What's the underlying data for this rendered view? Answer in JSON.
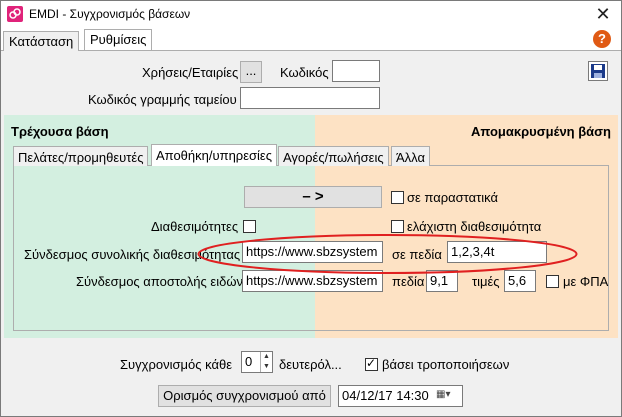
{
  "window": {
    "title": "EMDI - Συγχρονισμός βάσεων",
    "close_glyph": "✕"
  },
  "tabs": [
    {
      "label": "Κατάσταση"
    },
    {
      "label": "Ρυθμίσεις"
    }
  ],
  "help_glyph": "?",
  "settings": {
    "fiscal_years_label": "Χρήσεις/Εταιρίες",
    "browse_button": "...",
    "code_label": "Κωδικός",
    "code_value": "",
    "cashline_label": "Κωδικός γραμμής ταμείου",
    "cashline_value": ""
  },
  "current_db": {
    "title": "Τρέχουσα βάση"
  },
  "remote_db": {
    "title": "Απομακρυσμένη βάση"
  },
  "subtabs": [
    {
      "label": "Πελάτες/προμηθευτές"
    },
    {
      "label": "Αποθήκη/υπηρεσίες"
    },
    {
      "label": "Αγορές/πωλήσεις"
    },
    {
      "label": "Άλλα"
    }
  ],
  "warehouse": {
    "direction_button": "–   >",
    "in_documents_label": "σε παραστατικά",
    "availability_label": "Διαθεσιμότητες",
    "min_availability_label": "ελάχιστη διαθεσιμότητα",
    "total_availability_link_label": "Σύνδεσμος συνολικής διαθεσιμότητας",
    "total_availability_link_value": "https://www.sbzsystem",
    "fields_label": "σε πεδία",
    "fields_value": "1,2,3,4t",
    "shipping_link_label": "Σύνδεσμος αποστολής ειδών",
    "shipping_link_value": "https://www.sbzsystem",
    "field_label": "πεδία",
    "field_value": "9,1",
    "prices_label": "τιμές",
    "prices_value": "5,6",
    "with_vat_label": "με ΦΠΑ"
  },
  "sync": {
    "every_label": "Συγχρονισμός κάθε",
    "every_value": "0",
    "seconds_label": "δευτερόλ...",
    "based_on_changes_label": "βάσει τροποποιήσεων",
    "set_sync_from_button": "Ορισμός συγχρονισμού από",
    "datetime_value": "04/12/17 14:30"
  },
  "colors": {
    "current_db_bg": "#d3efe0",
    "remote_db_bg": "#fde2c4",
    "annotation": "#e02020",
    "app_icon": "#e0237a",
    "help_icon": "#e05a14"
  }
}
